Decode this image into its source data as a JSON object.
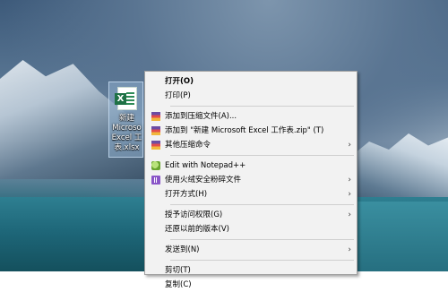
{
  "desktop_icon": {
    "label": "新建\nMicroso\nExcel 工\n表.xlsx"
  },
  "context_menu": {
    "items": [
      {
        "label": "打开(O)",
        "bold": true,
        "icon": "",
        "submenu": false
      },
      {
        "label": "打印(P)",
        "bold": false,
        "icon": "",
        "submenu": false
      },
      {
        "separator": true
      },
      {
        "label": "添加到压缩文件(A)...",
        "icon": "winrar-icon",
        "submenu": false
      },
      {
        "label": "添加到 \"新建 Microsoft Excel 工作表.zip\" (T)",
        "icon": "winrar-icon",
        "submenu": false
      },
      {
        "label": "其他压缩命令",
        "icon": "winrar-icon",
        "submenu": true
      },
      {
        "separator": true
      },
      {
        "label": "Edit with Notepad++",
        "icon": "notepad-plus-plus-icon",
        "submenu": false
      },
      {
        "label": "使用火绒安全粉碎文件",
        "icon": "shredder-icon",
        "submenu": true
      },
      {
        "label": "打开方式(H)",
        "icon": "",
        "submenu": true
      },
      {
        "separator": true
      },
      {
        "label": "授予访问权限(G)",
        "icon": "",
        "submenu": true
      },
      {
        "label": "还原以前的版本(V)",
        "icon": "",
        "submenu": false
      },
      {
        "separator": true
      },
      {
        "label": "发送到(N)",
        "icon": "",
        "submenu": true
      },
      {
        "separator": true
      },
      {
        "label": "剪切(T)",
        "icon": "",
        "submenu": false
      },
      {
        "label": "复制(C)",
        "icon": "",
        "submenu": false
      }
    ]
  },
  "arrow_glyph": "›",
  "excel_letter": "X"
}
